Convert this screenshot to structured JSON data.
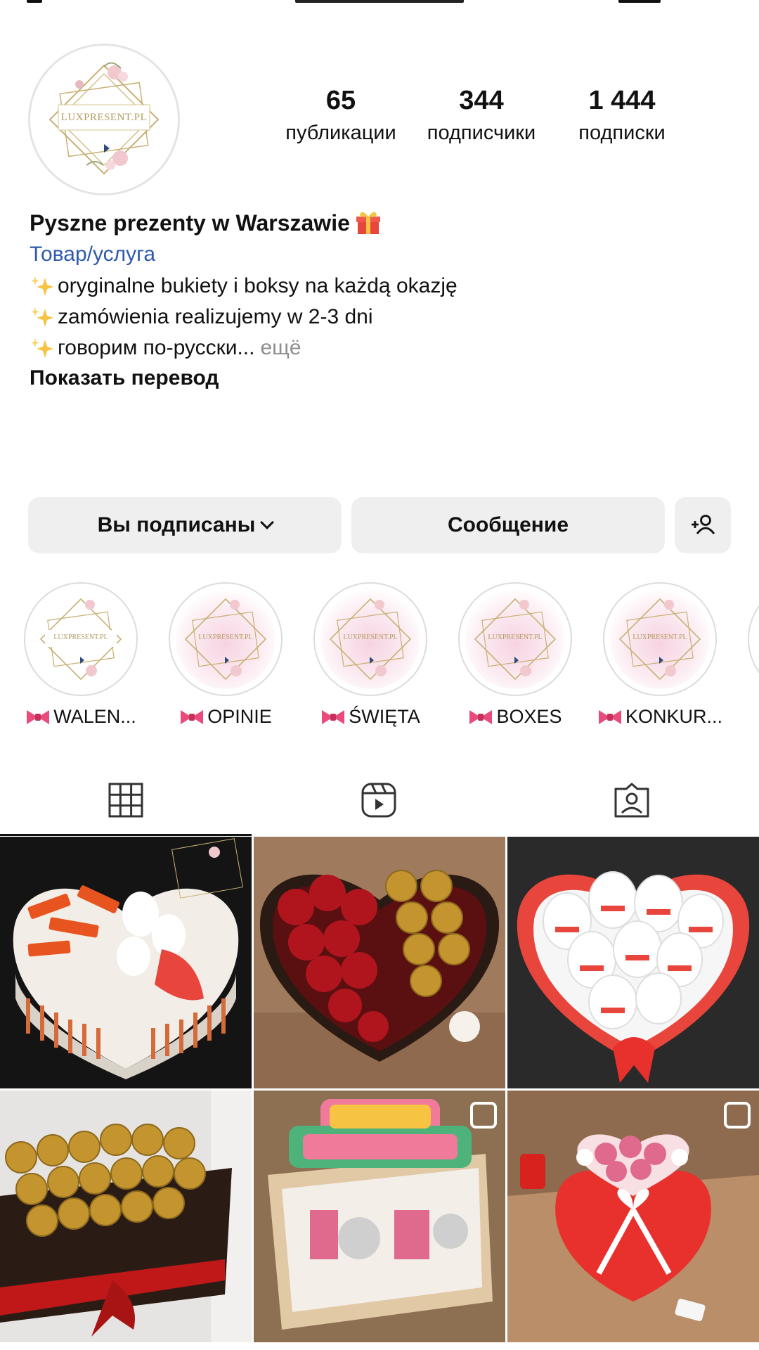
{
  "profile": {
    "avatar_label": "LUXPRESENT.PL",
    "name": "Pyszne prezenty w Warszawie",
    "category": "Товар/услуга",
    "bio_lines": [
      "oryginalne bukiety i boksy na każdą okazję",
      "zamówienia realizujemy w 2-3 dni",
      "говорим по-русски..."
    ],
    "more": "ещё",
    "translate": "Показать перевод"
  },
  "stats": {
    "posts": {
      "value": "65",
      "label": "публикации"
    },
    "followers": {
      "value": "344",
      "label": "подписчики"
    },
    "following": {
      "value": "1 444",
      "label": "подписки"
    }
  },
  "actions": {
    "follow": "Вы подписаны",
    "message": "Сообщение",
    "add_user_icon": "add-user-icon"
  },
  "highlights": [
    {
      "label": "WALEN...",
      "logo": "LUXPRESENT.PL"
    },
    {
      "label": "OPINIE",
      "logo": "LUXPRESENT.PL"
    },
    {
      "label": "ŚWIĘTA",
      "logo": "LUXPRESENT.PL"
    },
    {
      "label": "BOXES",
      "logo": "LUXPRESENT.PL"
    },
    {
      "label": "KONKUR...",
      "logo": "LUXPRESENT.PL"
    }
  ],
  "tabs": [
    {
      "icon": "grid-icon",
      "active": true
    },
    {
      "icon": "reels-icon",
      "active": false
    },
    {
      "icon": "tagged-icon",
      "active": false
    }
  ],
  "posts": [
    {
      "icon": "heart-box-kinder-bueno"
    },
    {
      "icon": "heart-box-roses-ferrero"
    },
    {
      "icon": "heart-box-kinder-eggs"
    },
    {
      "icon": "ferrero-bouquet"
    },
    {
      "icon": "happy-birthday-box"
    },
    {
      "icon": "raffaello-roses-box"
    }
  ],
  "colors": {
    "link": "#2e5aa7",
    "button_bg": "#efefef",
    "logo_gold": "#b49b62"
  }
}
